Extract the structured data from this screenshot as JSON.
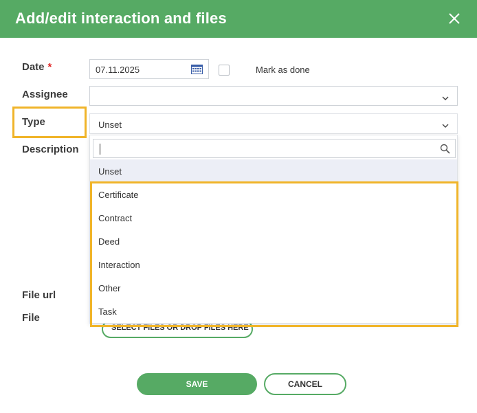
{
  "dialog": {
    "title": "Add/edit interaction and files"
  },
  "form": {
    "date_label": "Date",
    "required_mark": "*",
    "date_value": "07.11.2025",
    "mark_done_label": "Mark as done",
    "assignee_label": "Assignee",
    "assignee_value": "",
    "type_label": "Type",
    "type_value": "Unset",
    "description_label": "Description",
    "file_url_label": "File url",
    "file_label": "File",
    "upload_button_label": "SELECT FILES OR DROP FILES HERE"
  },
  "dropdown": {
    "search_value": "",
    "options": [
      "Unset",
      "Certificate",
      "Contract",
      "Deed",
      "Interaction",
      "Other",
      "Task"
    ],
    "selected": "Unset"
  },
  "buttons": {
    "save": "SAVE",
    "cancel": "CANCEL"
  },
  "colors": {
    "header": "#56aa64",
    "highlight": "#f0b429",
    "required": "#e02020"
  }
}
